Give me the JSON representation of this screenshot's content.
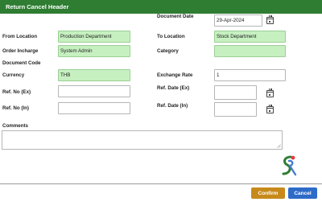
{
  "dialog": {
    "title": "Return Cancel Header"
  },
  "form": {
    "document_date": {
      "label": "Document Date",
      "value": "29-Apr-2024"
    },
    "from_location": {
      "label": "From Location",
      "value": "Production Department"
    },
    "to_location": {
      "label": "To Location",
      "value": "Stock Department"
    },
    "order_incharge": {
      "label": "Order Incharge",
      "value": "System Admin"
    },
    "category": {
      "label": "Category",
      "value": ""
    },
    "document_code": {
      "label": "Document Code"
    },
    "currency": {
      "label": "Currency",
      "value": "THB"
    },
    "exchange_rate": {
      "label": "Exchange Rate",
      "value": "1"
    },
    "ref_no_ex": {
      "label": "Ref. No (Ex)",
      "value": ""
    },
    "ref_date_ex": {
      "label": "Ref. Date (Ex)",
      "value": ""
    },
    "ref_no_in": {
      "label": "Ref. No (In)",
      "value": ""
    },
    "ref_date_in": {
      "label": "Ref. Date (In)",
      "value": ""
    },
    "comments": {
      "label": "Comments",
      "value": ""
    }
  },
  "icons": {
    "calendar": "calendar-icon",
    "resize": "resize-handle-icon",
    "logo": "brand-logo"
  },
  "buttons": {
    "confirm": "Confirm",
    "cancel": "Cancel"
  },
  "colors": {
    "header": "#2e7d32",
    "readonly_field": "#c6f0c0",
    "confirm": "#c78a1a",
    "cancel": "#2d6bc9"
  }
}
